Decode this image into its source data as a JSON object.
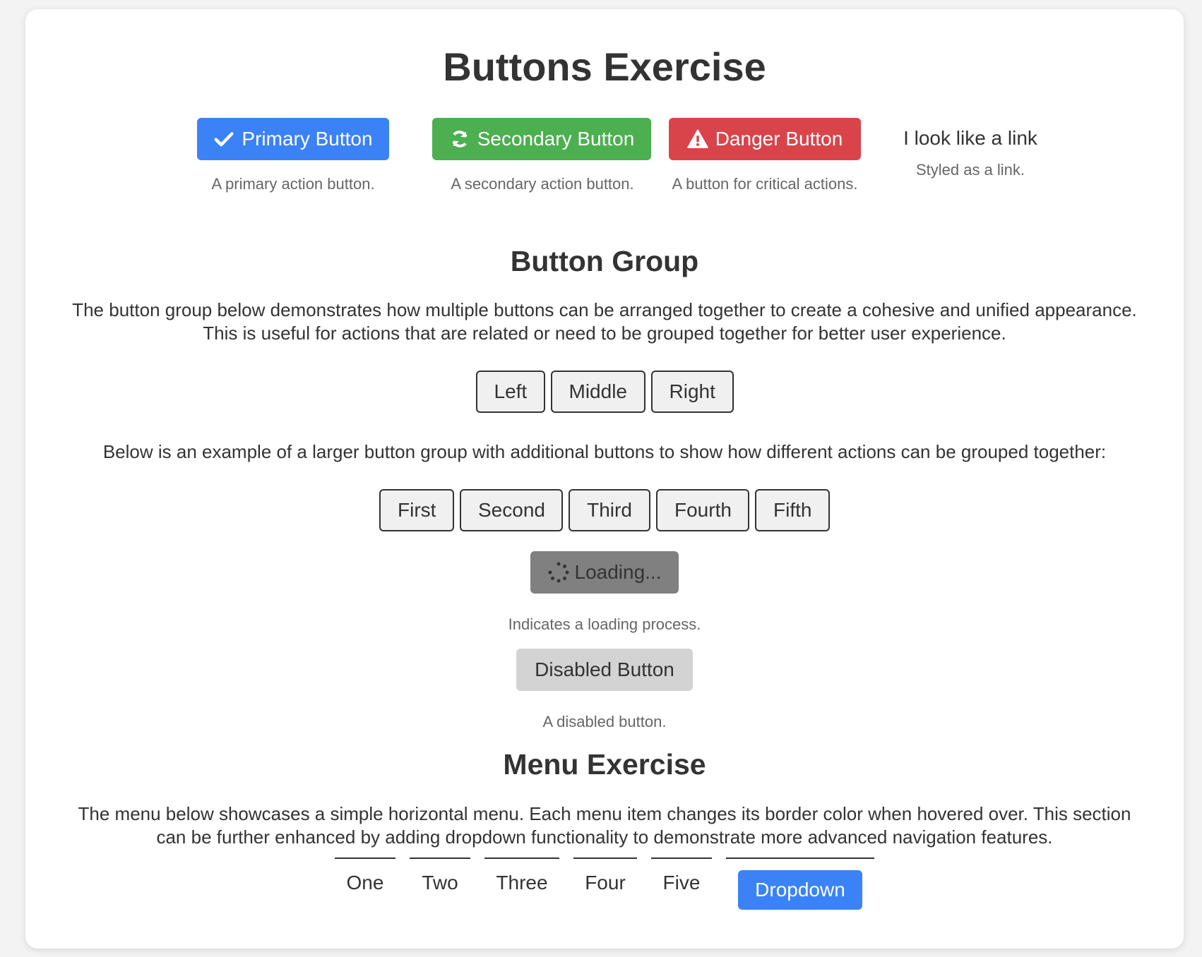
{
  "header": {
    "title": "Buttons Exercise"
  },
  "top_buttons": [
    {
      "label": "Primary Button",
      "caption": "A primary action button.",
      "color": "#3b82f6",
      "icon": "check-icon"
    },
    {
      "label": "Secondary Button",
      "caption": "A secondary action button.",
      "color": "#4caf50",
      "icon": "refresh-icon"
    },
    {
      "label": "Danger Button",
      "caption": "A button for critical actions.",
      "color": "#d9444a",
      "icon": "warning-icon"
    },
    {
      "label": "I look like a link",
      "caption": "Styled as a link."
    }
  ],
  "button_group": {
    "title": "Button Group",
    "description": "The button group below demonstrates how multiple buttons can be arranged together to create a cohesive and unified appearance. This is useful for actions that are related or need to be grouped together for better user experience.",
    "small_group": [
      "Left",
      "Middle",
      "Right"
    ],
    "large_intro": "Below is an example of a larger button group with additional buttons to show how different actions can be grouped together:",
    "large_group": [
      "First",
      "Second",
      "Third",
      "Fourth",
      "Fifth"
    ]
  },
  "loading": {
    "label": "Loading...",
    "caption": "Indicates a loading process.",
    "icon": "spinner-icon"
  },
  "disabled": {
    "label": "Disabled Button",
    "caption": "A disabled button."
  },
  "menu": {
    "title": "Menu Exercise",
    "description": "The menu below showcases a simple horizontal menu. Each menu item changes its border color when hovered over. This section can be further enhanced by adding dropdown functionality to demonstrate more advanced navigation features.",
    "items": [
      "One",
      "Two",
      "Three",
      "Four",
      "Five"
    ],
    "dropdown_label": "Dropdown"
  }
}
